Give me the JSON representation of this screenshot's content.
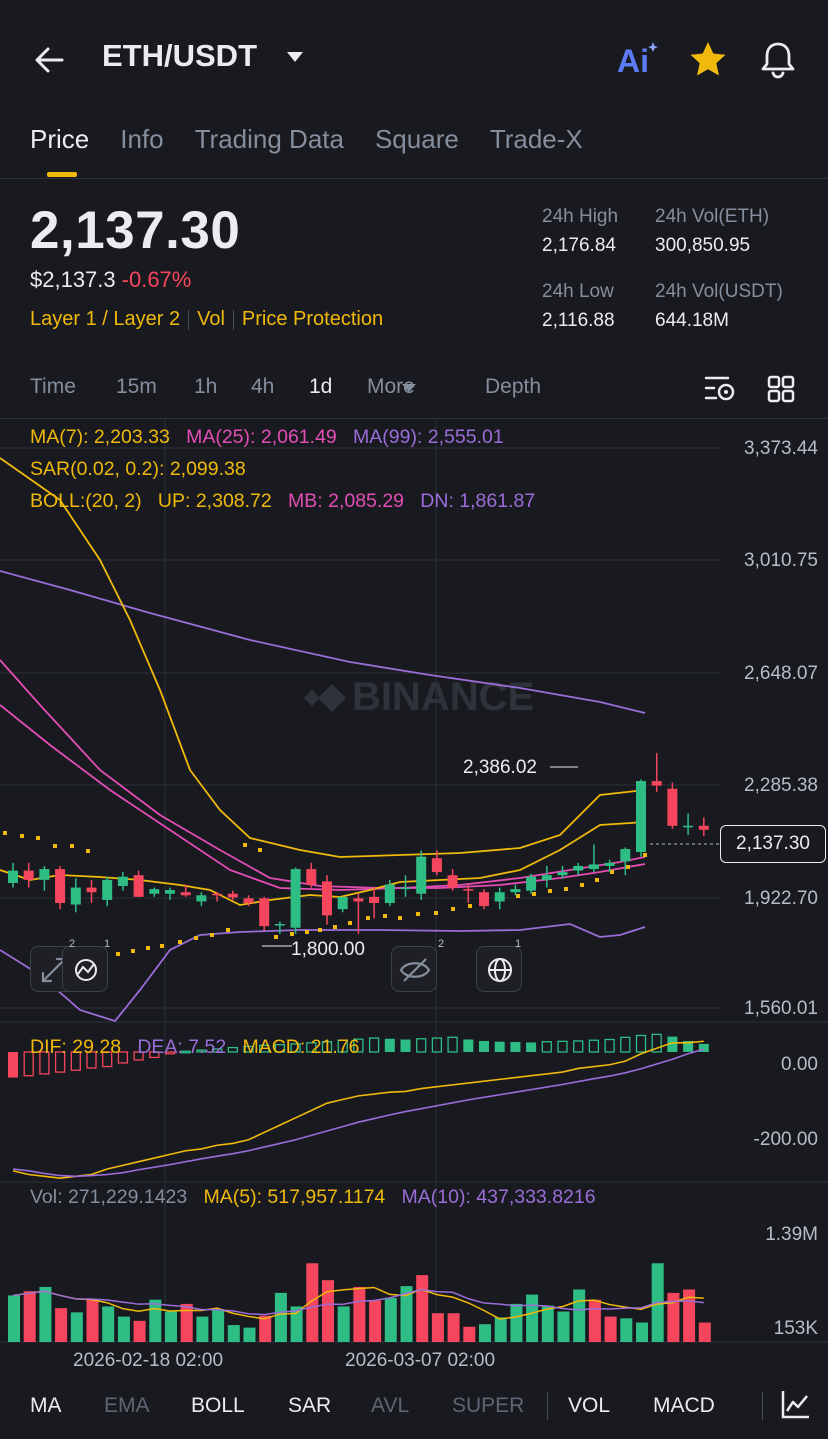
{
  "header": {
    "pair": "ETH/USDT",
    "icons": [
      "back-arrow-icon",
      "ai-icon",
      "star-icon",
      "bell-icon"
    ],
    "colors": {
      "star": "#f0b90b",
      "ai": "#5b7cf6"
    }
  },
  "tabs": [
    "Price",
    "Info",
    "Trading Data",
    "Square",
    "Trade-X"
  ],
  "price": {
    "last": "2,137.30",
    "usd": "$2,137.3",
    "change": "-0.67%",
    "tags": [
      "Layer 1 / Layer 2",
      "Vol",
      "Price Protection"
    ]
  },
  "stats": {
    "high_label": "24h High",
    "high": "2,176.84",
    "vol_eth_label": "24h Vol(ETH)",
    "vol_eth": "300,850.95",
    "low_label": "24h Low",
    "low": "2,116.88",
    "vol_usdt_label": "24h Vol(USDT)",
    "vol_usdt": "644.18M"
  },
  "intervals": {
    "items": [
      "Time",
      "15m",
      "1h",
      "4h",
      "1d",
      "More",
      "Depth"
    ],
    "selected": "1d"
  },
  "indicators": {
    "ma7": "MA(7): 2,203.33",
    "ma25": "MA(25): 2,061.49",
    "ma99": "MA(99): 2,555.01",
    "sar": "SAR(0.02, 0.2): 2,099.38",
    "boll": "BOLL:(20, 2)",
    "up": "UP: 2,308.72",
    "mb": "MB: 2,085.29",
    "dn": "DN: 1,861.87"
  },
  "price_axis": [
    "3,373.44",
    "3,010.75",
    "2,648.07",
    "2,285.38",
    "1,922.70",
    "1,560.01"
  ],
  "current_price_tag": "2,137.30",
  "high_marker": "2,386.02",
  "low_marker": "1,800.00",
  "watermark": "BINANCE",
  "tool_badges": [
    "2",
    "1",
    "2",
    "1"
  ],
  "macd": {
    "dif": "DIF: 29.28",
    "dea": "DEA: 7.52",
    "macd": "MACD: 21.76",
    "axis": [
      "0.00",
      "-200.00"
    ]
  },
  "volume": {
    "vol": "Vol: 271,229.1423",
    "ma5": "MA(5): 517,957.1174",
    "ma10": "MA(10): 437,333.8216",
    "axis": [
      "1.39M",
      "153K"
    ]
  },
  "dates": [
    "2026-02-18 02:00",
    "2026-03-07 02:00"
  ],
  "bottom_bar": {
    "items": [
      "MA",
      "EMA",
      "BOLL",
      "SAR",
      "AVL",
      "SUPER",
      "VOL",
      "MACD"
    ],
    "active": [
      "MA",
      "BOLL",
      "SAR",
      "VOL",
      "MACD"
    ]
  },
  "chart_data": {
    "type": "candlestick",
    "ylim": [
      1560.01,
      3373.44
    ],
    "candles": [
      {
        "o": 1965,
        "h": 2030,
        "l": 1950,
        "c": 2005
      },
      {
        "o": 2005,
        "h": 2030,
        "l": 1950,
        "c": 1975
      },
      {
        "o": 1975,
        "h": 2020,
        "l": 1940,
        "c": 2010
      },
      {
        "o": 2010,
        "h": 2020,
        "l": 1880,
        "c": 1900
      },
      {
        "o": 1895,
        "h": 1980,
        "l": 1870,
        "c": 1950
      },
      {
        "o": 1950,
        "h": 1975,
        "l": 1900,
        "c": 1935
      },
      {
        "o": 1910,
        "h": 1985,
        "l": 1890,
        "c": 1975
      },
      {
        "o": 1955,
        "h": 2000,
        "l": 1940,
        "c": 1985
      },
      {
        "o": 1990,
        "h": 2005,
        "l": 1920,
        "c": 1920
      },
      {
        "o": 1930,
        "h": 1950,
        "l": 1920,
        "c": 1945
      },
      {
        "o": 1930,
        "h": 1950,
        "l": 1910,
        "c": 1942
      },
      {
        "o": 1935,
        "h": 1960,
        "l": 1920,
        "c": 1925
      },
      {
        "o": 1905,
        "h": 1935,
        "l": 1890,
        "c": 1925
      },
      {
        "o": 1930,
        "h": 1935,
        "l": 1905,
        "c": 1925
      },
      {
        "o": 1930,
        "h": 1940,
        "l": 1910,
        "c": 1918
      },
      {
        "o": 1915,
        "h": 1925,
        "l": 1890,
        "c": 1900
      },
      {
        "o": 1915,
        "h": 1920,
        "l": 1810,
        "c": 1825
      },
      {
        "o": 1830,
        "h": 1840,
        "l": 1800,
        "c": 1832
      },
      {
        "o": 1820,
        "h": 2015,
        "l": 1800,
        "c": 2010
      },
      {
        "o": 2010,
        "h": 2030,
        "l": 1950,
        "c": 1960
      },
      {
        "o": 1970,
        "h": 1990,
        "l": 1830,
        "c": 1860
      },
      {
        "o": 1880,
        "h": 1920,
        "l": 1870,
        "c": 1920
      },
      {
        "o": 1915,
        "h": 1930,
        "l": 1800,
        "c": 1905
      },
      {
        "o": 1920,
        "h": 1950,
        "l": 1850,
        "c": 1900
      },
      {
        "o": 1900,
        "h": 1975,
        "l": 1890,
        "c": 1960
      },
      {
        "o": 1945,
        "h": 1990,
        "l": 1920,
        "c": 1950
      },
      {
        "o": 1930,
        "h": 2070,
        "l": 1910,
        "c": 2050
      },
      {
        "o": 2045,
        "h": 2070,
        "l": 1990,
        "c": 2000
      },
      {
        "o": 1990,
        "h": 2010,
        "l": 1940,
        "c": 1950
      },
      {
        "o": 1945,
        "h": 1960,
        "l": 1900,
        "c": 1940
      },
      {
        "o": 1935,
        "h": 1945,
        "l": 1880,
        "c": 1890
      },
      {
        "o": 1905,
        "h": 1950,
        "l": 1880,
        "c": 1935
      },
      {
        "o": 1935,
        "h": 1960,
        "l": 1925,
        "c": 1945
      },
      {
        "o": 1940,
        "h": 1995,
        "l": 1930,
        "c": 1985
      },
      {
        "o": 1975,
        "h": 2020,
        "l": 1950,
        "c": 1990
      },
      {
        "o": 1990,
        "h": 2020,
        "l": 1980,
        "c": 2000
      },
      {
        "o": 2005,
        "h": 2030,
        "l": 1990,
        "c": 2020
      },
      {
        "o": 2010,
        "h": 2090,
        "l": 2000,
        "c": 2025
      },
      {
        "o": 2020,
        "h": 2040,
        "l": 2000,
        "c": 2030
      },
      {
        "o": 2035,
        "h": 2080,
        "l": 1990,
        "c": 2075
      },
      {
        "o": 2065,
        "h": 2300,
        "l": 2050,
        "c": 2295
      },
      {
        "o": 2295,
        "h": 2386.02,
        "l": 2260,
        "c": 2280
      },
      {
        "o": 2270,
        "h": 2290,
        "l": 2140,
        "c": 2150
      },
      {
        "o": 2150,
        "h": 2190,
        "l": 2120,
        "c": 2150
      },
      {
        "o": 2150,
        "h": 2176.84,
        "l": 2116.88,
        "c": 2137.3
      }
    ],
    "macd": {
      "ylim": [
        -350,
        60
      ],
      "histogram": [
        -70,
        -65,
        -60,
        -55,
        -50,
        -44,
        -40,
        -30,
        -22,
        -15,
        -5,
        2,
        5,
        8,
        12,
        15,
        18,
        20,
        22,
        25,
        28,
        32,
        35,
        38,
        36,
        34,
        36,
        38,
        40,
        34,
        30,
        28,
        27,
        26,
        28,
        29,
        30,
        32,
        34,
        40,
        45,
        48,
        42,
        30,
        22
      ],
      "dif": [
        -325,
        -335,
        -340,
        -345,
        -340,
        -335,
        -320,
        -310,
        -300,
        -290,
        -280,
        -270,
        -265,
        -255,
        -250,
        -240,
        -220,
        -200,
        -180,
        -160,
        -140,
        -130,
        -120,
        -115,
        -110,
        -108,
        -100,
        -95,
        -90,
        -85,
        -80,
        -75,
        -70,
        -65,
        -60,
        -55,
        -45,
        -40,
        -35,
        -25,
        -5,
        10,
        25,
        25,
        29.28
      ],
      "dea": [
        -320,
        -325,
        -332,
        -338,
        -340,
        -338,
        -335,
        -330,
        -322,
        -315,
        -308,
        -300,
        -292,
        -285,
        -278,
        -270,
        -260,
        -250,
        -240,
        -228,
        -216,
        -204,
        -192,
        -182,
        -172,
        -163,
        -155,
        -147,
        -139,
        -131,
        -124,
        -117,
        -110,
        -103,
        -96,
        -89,
        -81,
        -73,
        -66,
        -57,
        -46,
        -33,
        -20,
        -5,
        7.52
      ]
    },
    "volume": {
      "ylim": [
        0,
        1500000
      ],
      "values": [
        550000,
        600000,
        650000,
        400000,
        350000,
        500000,
        420000,
        300000,
        250000,
        500000,
        360000,
        450000,
        300000,
        390000,
        200000,
        170000,
        310000,
        580000,
        420000,
        930000,
        730000,
        420000,
        650000,
        490000,
        520000,
        660000,
        790000,
        340000,
        340000,
        180000,
        210000,
        290000,
        450000,
        560000,
        430000,
        360000,
        620000,
        500000,
        300000,
        280000,
        230000,
        930000,
        580000,
        620000,
        230000
      ],
      "up": [
        true,
        false,
        true,
        false,
        true,
        false,
        true,
        true,
        false,
        true,
        true,
        false,
        true,
        true,
        true,
        true,
        false,
        true,
        true,
        false,
        false,
        true,
        false,
        false,
        true,
        true,
        false,
        false,
        false,
        false,
        true,
        true,
        true,
        true,
        true,
        true,
        true,
        false,
        false,
        true,
        true,
        true,
        false,
        false,
        false
      ]
    },
    "dates": [
      "2026-02-18 02:00",
      "2026-03-07 02:00"
    ]
  }
}
